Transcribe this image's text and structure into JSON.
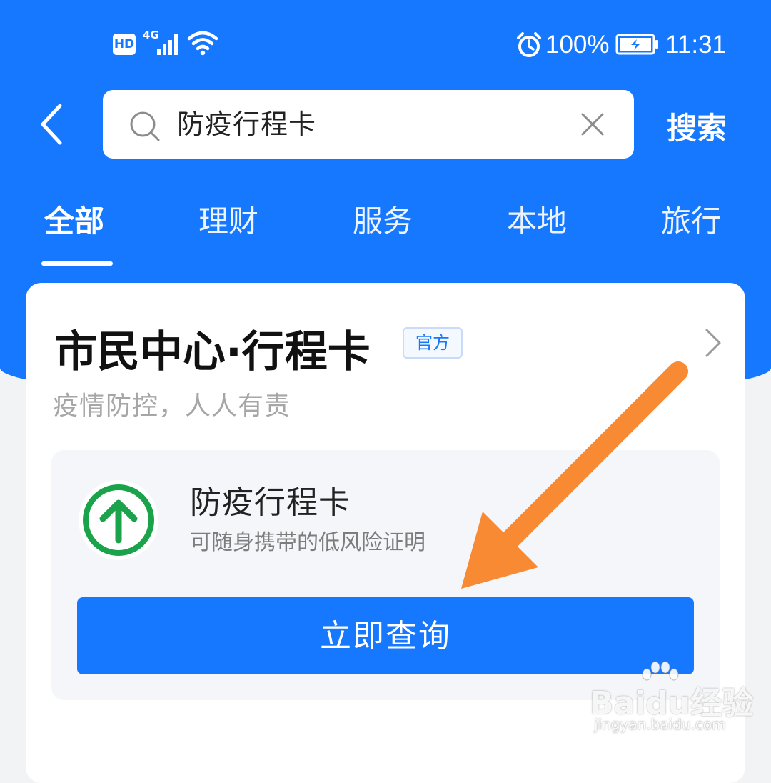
{
  "status_bar": {
    "hd": "HD",
    "network": "4G",
    "battery_percent": "100%",
    "time": "11:31"
  },
  "search": {
    "query": "防疫行程卡",
    "button_label": "搜索"
  },
  "tabs": [
    {
      "label": "全部",
      "active": true
    },
    {
      "label": "理财",
      "active": false
    },
    {
      "label": "服务",
      "active": false
    },
    {
      "label": "本地",
      "active": false
    },
    {
      "label": "旅行",
      "active": false
    }
  ],
  "result_card": {
    "title": "市民中心·行程卡",
    "badge": "官方",
    "subtitle": "疫情防控，人人有责",
    "service": {
      "name": "防疫行程卡",
      "description": "可随身携带的低风险证明",
      "button_label": "立即查询",
      "logo_icon": "up-arrow-circle-icon"
    }
  },
  "annotation": {
    "arrow_color": "#f78a33"
  },
  "watermark": {
    "brand": "Baidu经验",
    "url": "jingyan.baidu.com"
  },
  "colors": {
    "primary": "#1677ff",
    "logo_green": "#1aa34a"
  }
}
